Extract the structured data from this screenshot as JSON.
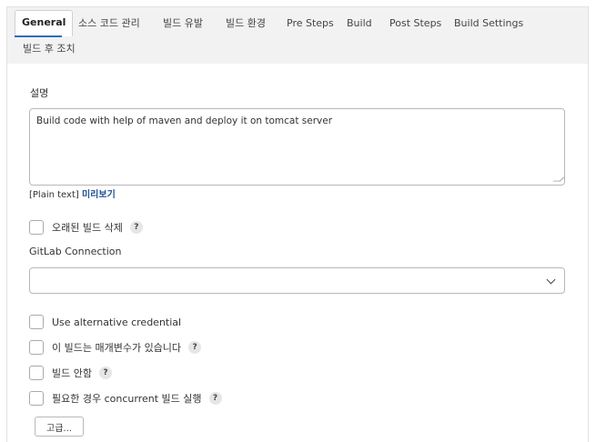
{
  "tabs": [
    {
      "label": "General",
      "active": true
    },
    {
      "label": "소스 코드 관리"
    },
    {
      "label": "빌드 유발"
    },
    {
      "label": "빌드 환경"
    },
    {
      "label": "Pre Steps"
    },
    {
      "label": "Build"
    },
    {
      "label": "Post Steps"
    },
    {
      "label": "Build Settings"
    },
    {
      "label": "빌드 후 조치"
    }
  ],
  "description": {
    "label": "설명",
    "value": "Build code with help of maven and deploy it on tomcat server",
    "format_text": "[Plain text]",
    "preview_link": "미리보기"
  },
  "discard_old_builds": {
    "label": "오래된 빌드 삭제",
    "checked": false,
    "help": "?"
  },
  "gitlab_connection": {
    "label": "GitLab Connection",
    "selected": ""
  },
  "options": [
    {
      "label": "Use alternative credential",
      "checked": false,
      "help": ""
    },
    {
      "label": "이 빌드는 매개변수가 있습니다",
      "checked": false,
      "help": "?"
    },
    {
      "label": "빌드 안함",
      "checked": false,
      "help": "?"
    },
    {
      "label": "필요한 경우 concurrent 빌드 실행",
      "checked": false,
      "help": "?"
    }
  ],
  "advanced_button": "고급..."
}
